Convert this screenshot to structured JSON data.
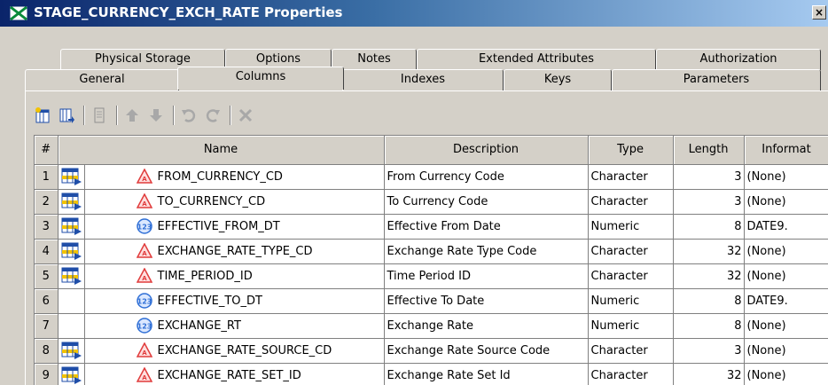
{
  "window": {
    "title": "STAGE_CURRENCY_EXCH_RATE Properties",
    "close_glyph": "×"
  },
  "tabs": {
    "back_row": [
      "Physical Storage",
      "Options",
      "Notes",
      "Extended Attributes",
      "Authorization"
    ],
    "front_row": [
      "General",
      "Columns",
      "Indexes",
      "Keys",
      "Parameters"
    ],
    "selected": "Columns"
  },
  "toolbar": {
    "buttons": [
      "new-column-icon",
      "import-column-icon",
      "properties-icon",
      "move-up-icon",
      "move-down-icon",
      "undo-icon",
      "redo-icon",
      "delete-icon"
    ]
  },
  "grid": {
    "headers": [
      "#",
      "Name",
      "Description",
      "Type",
      "Length",
      "Informat"
    ],
    "rows": [
      {
        "num": "1",
        "key": true,
        "kind": "character",
        "name": "FROM_CURRENCY_CD",
        "description": "From Currency Code",
        "type": "Character",
        "length": "3",
        "informat": "(None)"
      },
      {
        "num": "2",
        "key": true,
        "kind": "character",
        "name": "TO_CURRENCY_CD",
        "description": "To Currency Code",
        "type": "Character",
        "length": "3",
        "informat": "(None)"
      },
      {
        "num": "3",
        "key": true,
        "kind": "numeric",
        "name": "EFFECTIVE_FROM_DT",
        "description": "Effective From Date",
        "type": "Numeric",
        "length": "8",
        "informat": "DATE9."
      },
      {
        "num": "4",
        "key": true,
        "kind": "character",
        "name": "EXCHANGE_RATE_TYPE_CD",
        "description": "Exchange Rate Type Code",
        "type": "Character",
        "length": "32",
        "informat": "(None)"
      },
      {
        "num": "5",
        "key": true,
        "kind": "character",
        "name": "TIME_PERIOD_ID",
        "description": "Time Period ID",
        "type": "Character",
        "length": "32",
        "informat": "(None)"
      },
      {
        "num": "6",
        "key": false,
        "kind": "numeric",
        "name": "EFFECTIVE_TO_DT",
        "description": "Effective To Date",
        "type": "Numeric",
        "length": "8",
        "informat": "DATE9."
      },
      {
        "num": "7",
        "key": false,
        "kind": "numeric",
        "name": "EXCHANGE_RT",
        "description": "Exchange Rate",
        "type": "Numeric",
        "length": "8",
        "informat": "(None)"
      },
      {
        "num": "8",
        "key": true,
        "kind": "character",
        "name": "EXCHANGE_RATE_SOURCE_CD",
        "description": "Exchange Rate Source Code",
        "type": "Character",
        "length": "3",
        "informat": "(None)"
      },
      {
        "num": "9",
        "key": true,
        "kind": "character",
        "name": "EXCHANGE_RATE_SET_ID",
        "description": "Exchange Rate Set Id",
        "type": "Character",
        "length": "32",
        "informat": "(None)"
      }
    ]
  },
  "colors": {
    "titlebar_start": "#0a246a",
    "titlebar_end": "#a6caf0",
    "chrome": "#d4d0c8",
    "character_icon": "#e03c3c",
    "numeric_icon": "#2f6fd6"
  }
}
